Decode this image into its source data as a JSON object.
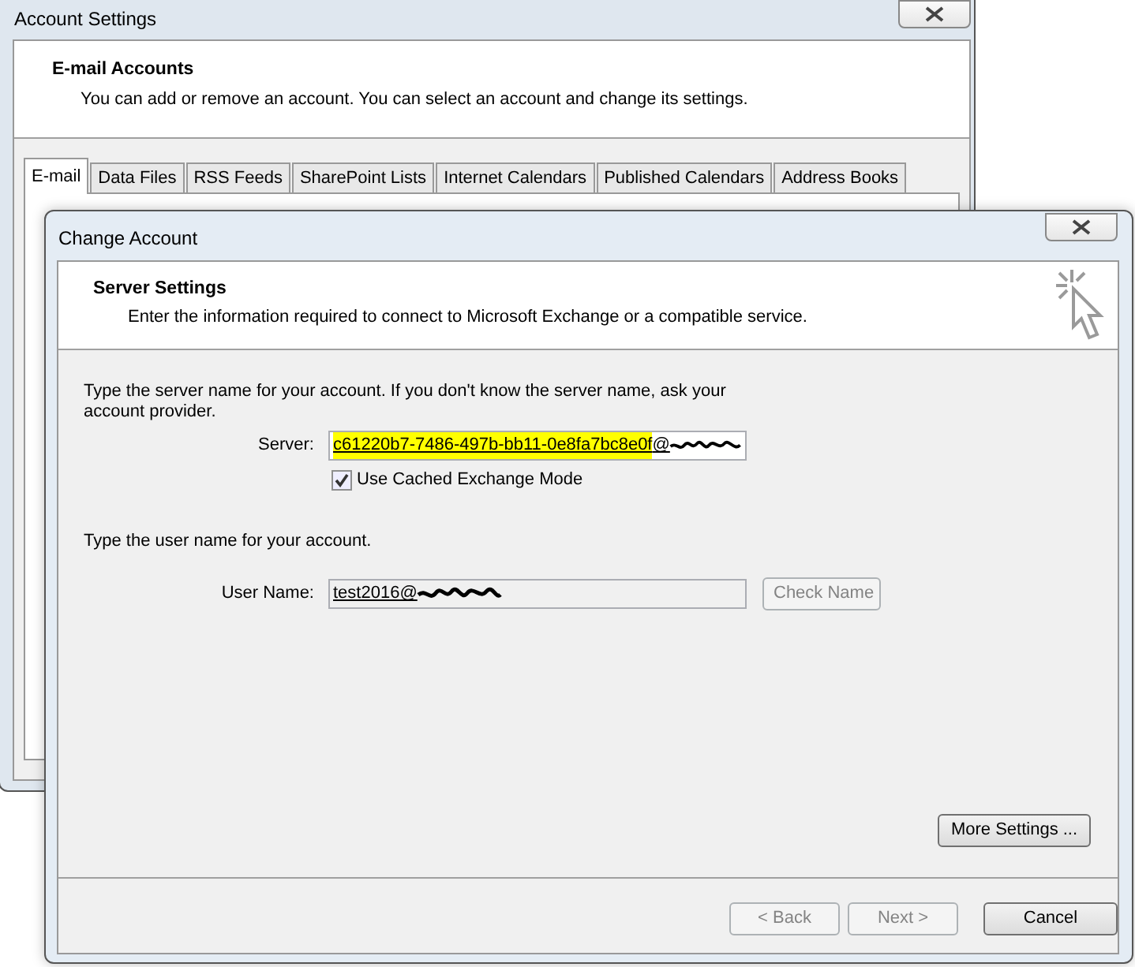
{
  "back_window": {
    "title": "Account Settings",
    "header": {
      "title": "E-mail Accounts",
      "description": "You can add or remove an account. You can select an account and change its settings."
    },
    "tabs": [
      {
        "label": "E-mail",
        "selected": true
      },
      {
        "label": "Data Files",
        "selected": false
      },
      {
        "label": "RSS Feeds",
        "selected": false
      },
      {
        "label": "SharePoint Lists",
        "selected": false
      },
      {
        "label": "Internet Calendars",
        "selected": false
      },
      {
        "label": "Published Calendars",
        "selected": false
      },
      {
        "label": "Address Books",
        "selected": false
      }
    ]
  },
  "dialog": {
    "title": "Change Account",
    "header": {
      "title": "Server Settings",
      "description": "Enter the information required to connect to Microsoft Exchange or a compatible service."
    },
    "server_prompt": "Type the server name for your account. If you don't know the server name, ask your account provider.",
    "server": {
      "label": "Server:",
      "value_highlighted": "c61220b7-7486-497b-bb11-0e8fa7bc8e0f",
      "value_rest": "@"
    },
    "cached_mode": {
      "label": "Use Cached Exchange Mode",
      "checked": true
    },
    "user_prompt": "Type the user name for your account.",
    "user": {
      "label": "User Name:",
      "value": "test2016@",
      "disabled": true
    },
    "check_name": {
      "label": "Check Name",
      "disabled": true
    },
    "more_settings": {
      "label": "More Settings ...",
      "disabled": false
    },
    "nav_buttons": [
      {
        "label": "< Back",
        "disabled": true
      },
      {
        "label": "Next >",
        "disabled": true
      },
      {
        "label": "Cancel",
        "disabled": false
      }
    ]
  }
}
